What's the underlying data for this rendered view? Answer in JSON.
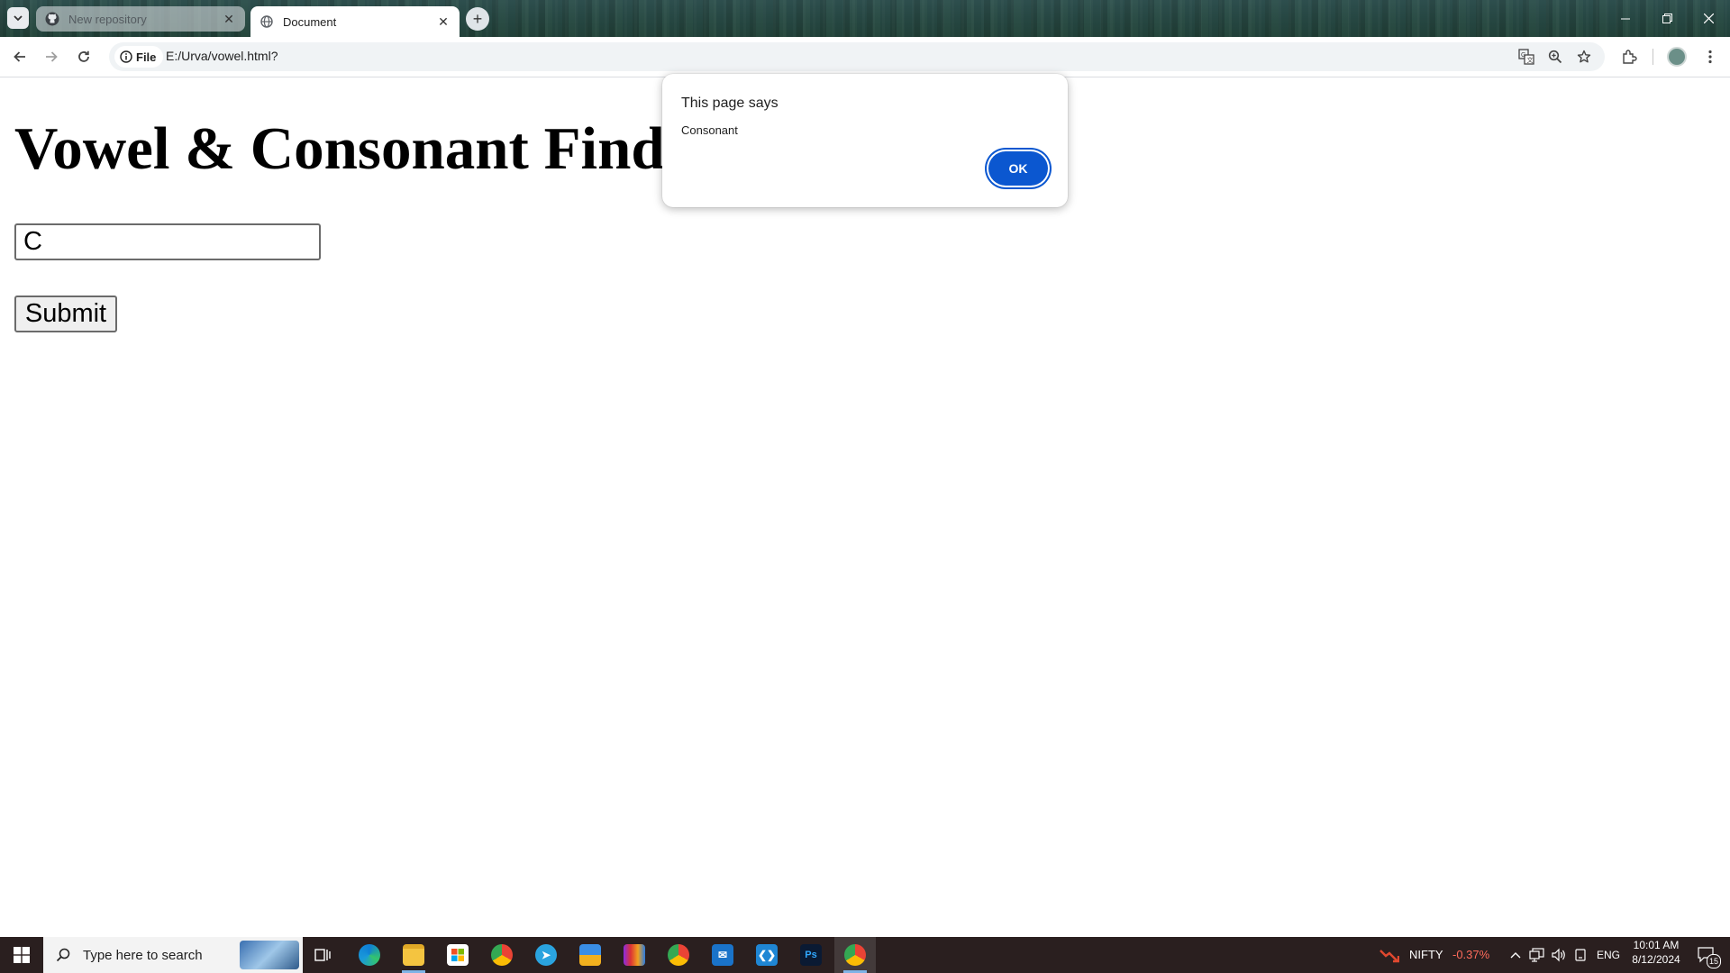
{
  "browser": {
    "tabs": [
      {
        "title": "New repository",
        "active": false,
        "favicon": "github-icon"
      },
      {
        "title": "Document",
        "active": true,
        "favicon": "globe-icon"
      }
    ],
    "omnibox": {
      "chip_label": "File",
      "url": "E:/Urva/vowel.html?"
    }
  },
  "page": {
    "heading": "Vowel & Consonant Finder",
    "input_value": "C",
    "submit_label": "Submit"
  },
  "alert": {
    "title": "This page says",
    "message": "Consonant",
    "ok_label": "OK"
  },
  "taskbar": {
    "search_placeholder": "Type here to search",
    "ticker_name": "NIFTY",
    "ticker_change": "-0.37%",
    "language": "ENG",
    "time": "10:01 AM",
    "date": "8/12/2024",
    "notification_count": "15"
  },
  "colors": {
    "ok_button": "#0b57d0",
    "ticker_negative": "#ff6b5b",
    "taskbar_bg": "#2a1f1f"
  }
}
